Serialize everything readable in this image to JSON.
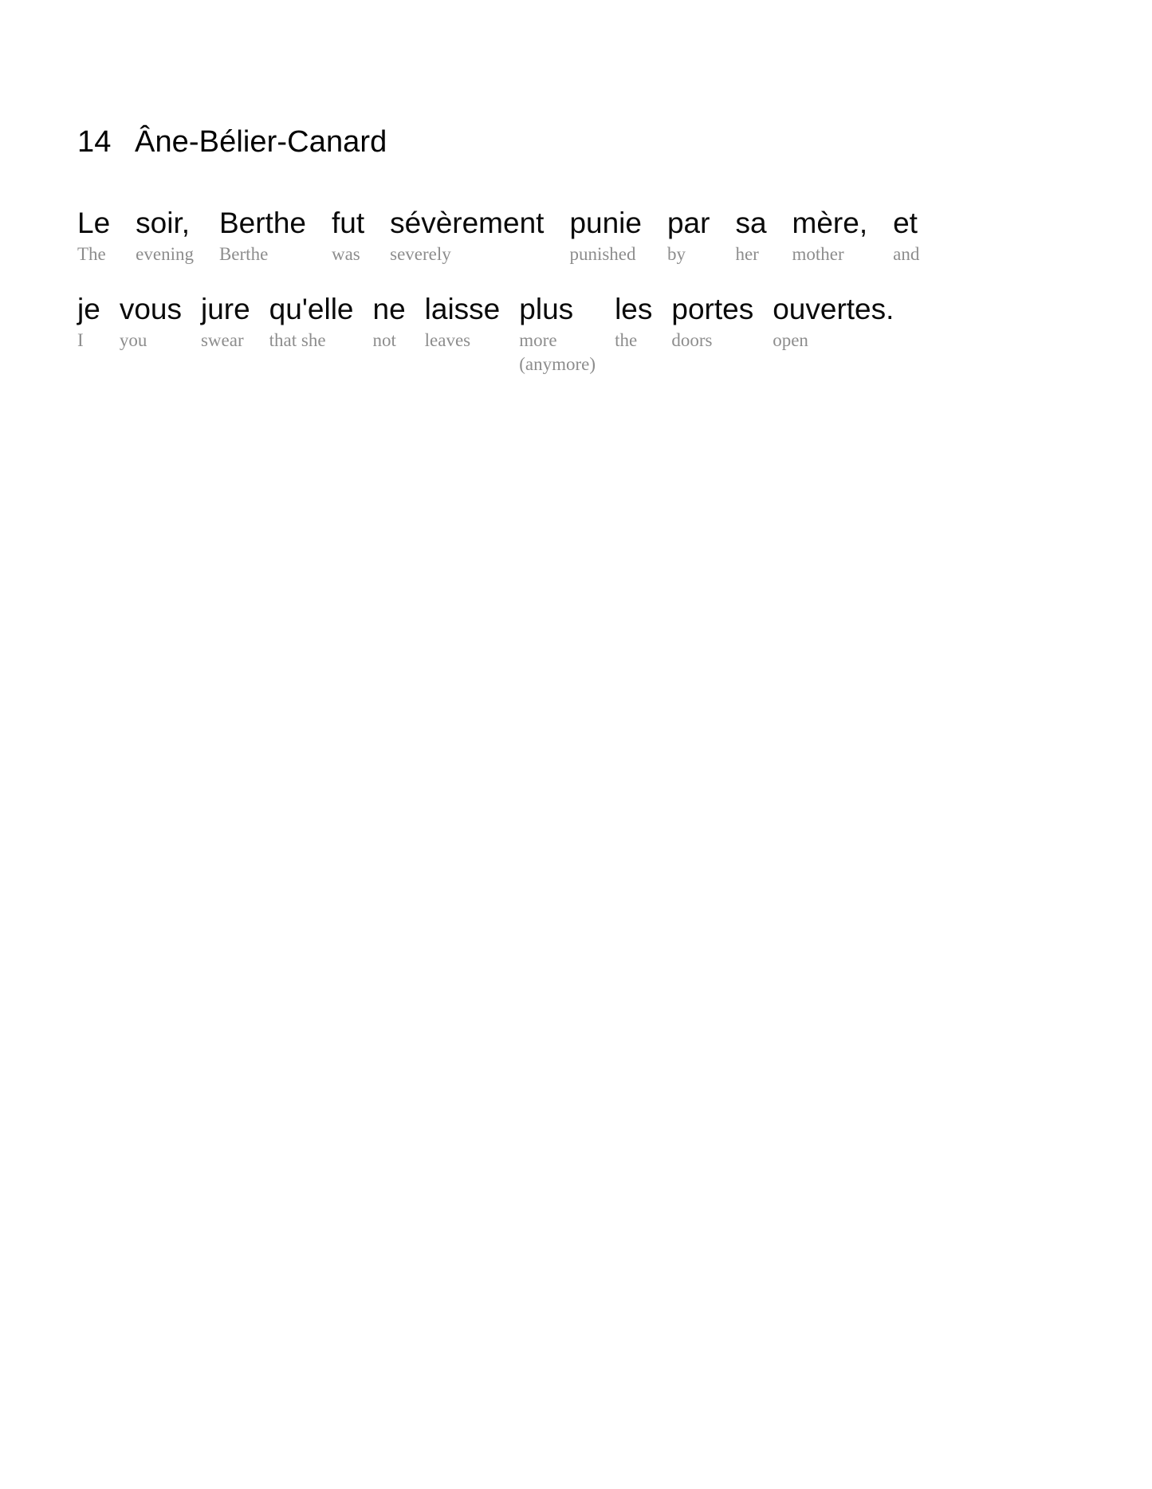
{
  "page": {
    "background": "#ffffff",
    "text_color": "#0a0a0a",
    "gloss_color": "#8d8d8d"
  },
  "heading": {
    "number": "14",
    "title": "Âne-Bélier-Canard"
  },
  "interlinear": {
    "lines": [
      {
        "id": "line-1",
        "pairs": [
          {
            "source": "Le",
            "gloss": "The"
          },
          {
            "source": "soir,",
            "gloss": "evening"
          },
          {
            "source": "Berthe",
            "gloss": "Berthe"
          },
          {
            "source": "fut",
            "gloss": "was"
          },
          {
            "source": "sévèrement",
            "gloss": "severely"
          },
          {
            "source": "punie",
            "gloss": "punished"
          },
          {
            "source": "par",
            "gloss": "by"
          },
          {
            "source": "sa",
            "gloss": "her"
          },
          {
            "source": "mère,",
            "gloss": "mother"
          },
          {
            "source": "et",
            "gloss": "and"
          }
        ]
      },
      {
        "id": "line-2",
        "pairs": [
          {
            "source": "je",
            "gloss": "I"
          },
          {
            "source": "vous",
            "gloss": "you"
          },
          {
            "source": "jure",
            "gloss": "swear"
          },
          {
            "source": "qu'elle",
            "gloss": "that she"
          },
          {
            "source": "ne",
            "gloss": "not"
          },
          {
            "source": "laisse",
            "gloss": "leaves"
          },
          {
            "source": "plus",
            "gloss": "more",
            "gloss_extra": "(anymore)"
          },
          {
            "source": "les",
            "gloss": "the"
          },
          {
            "source": "portes",
            "gloss": "doors"
          },
          {
            "source": "ouvertes.",
            "gloss": "open"
          }
        ]
      }
    ]
  },
  "full_text": {
    "source_sentence": "Le soir, Berthe fut sévèrement punie par sa mère, et je vous jure qu'elle ne laisse plus les portes ouvertes.",
    "gloss_sentence": "The evening Berthe was severely punished by her mother and I you swear that she not leaves more (anymore) the doors open"
  }
}
